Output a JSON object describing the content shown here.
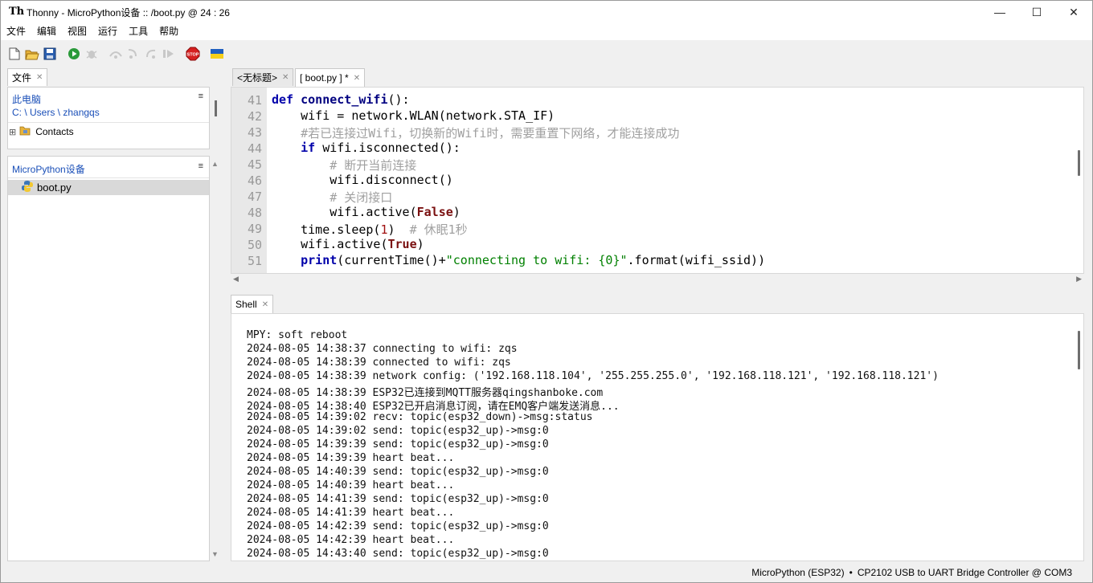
{
  "window": {
    "app_name": "Thonny",
    "title": "Thonny  -  MicroPython设备 :: /boot.py  @  24 : 26",
    "minimize": "—",
    "maximize": "☐",
    "close": "✕"
  },
  "menu": [
    "文件",
    "编辑",
    "视图",
    "运行",
    "工具",
    "帮助"
  ],
  "toolbar": {
    "icons": [
      "new-file-icon",
      "open-file-icon",
      "save-icon",
      "run-icon",
      "debug-icon",
      "step-over-icon",
      "step-into-icon",
      "step-out-icon",
      "resume-icon",
      "stop-icon",
      "ukraine-flag-icon"
    ],
    "stop_label": "STOP"
  },
  "files_pane": {
    "tab_label": "文件",
    "header_location": "此电脑",
    "path": "C: \\ Users \\ zhangqs",
    "menu_glyph": "≡",
    "items": [
      {
        "label": "Contacts",
        "expander": "⊞"
      }
    ]
  },
  "device_pane": {
    "header": "MicroPython设备",
    "menu_glyph": "≡",
    "items": [
      {
        "label": "boot.py"
      }
    ]
  },
  "editor": {
    "tabs": [
      {
        "label": "<无标题>",
        "active": false
      },
      {
        "label": "[ boot.py ] *",
        "active": true
      }
    ],
    "line_numbers": [
      "41",
      "42",
      "43",
      "44",
      "45",
      "46",
      "47",
      "48",
      "49",
      "50",
      "51"
    ]
  },
  "shell": {
    "tab_label": "Shell",
    "lines": [
      "MPY: soft reboot",
      "2024-08-05 14:38:37 connecting to wifi: zqs",
      "2024-08-05 14:38:39 connected to wifi: zqs",
      "2024-08-05 14:38:39 network config: ('192.168.118.104', '255.255.255.0', '192.168.118.121', '192.168.118.121')",
      "2024-08-05 14:38:39 ESP32已连接到MQTT服务器qingshanboke.com",
      "2024-08-05 14:38:40 ESP32已开启消息订阅，请在EMQ客户端发送消息...",
      "2024-08-05 14:39:02 recv: topic(esp32_down)->msg:status",
      "2024-08-05 14:39:02 send: topic(esp32_up)->msg:0",
      "2024-08-05 14:39:39 send: topic(esp32_up)->msg:0",
      "2024-08-05 14:39:39 heart beat...",
      "2024-08-05 14:40:39 send: topic(esp32_up)->msg:0",
      "2024-08-05 14:40:39 heart beat...",
      "2024-08-05 14:41:39 send: topic(esp32_up)->msg:0",
      "2024-08-05 14:41:39 heart beat...",
      "2024-08-05 14:42:39 send: topic(esp32_up)->msg:0",
      "2024-08-05 14:42:39 heart beat...",
      "2024-08-05 14:43:40 send: topic(esp32_up)->msg:0"
    ]
  },
  "status": {
    "interpreter": "MicroPython (ESP32)",
    "separator": "•",
    "port": "CP2102 USB to UART Bridge Controller @ COM3"
  }
}
